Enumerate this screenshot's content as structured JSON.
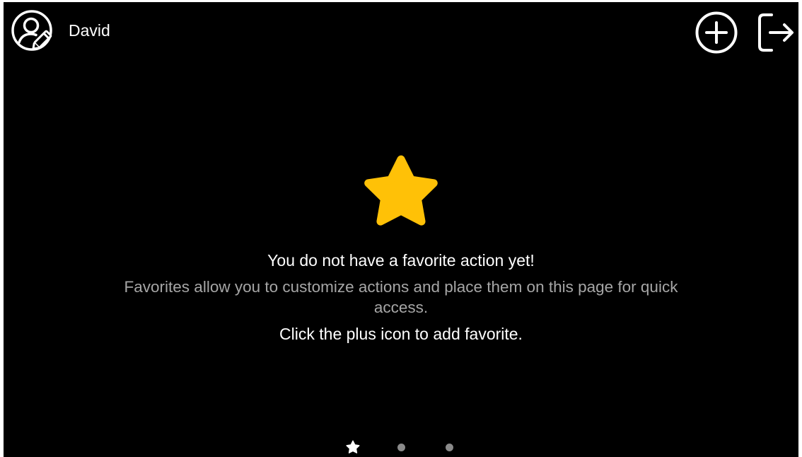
{
  "header": {
    "user_name": "David",
    "add_icon": "plus-circle-icon",
    "logout_icon": "logout-icon",
    "profile_icon": "user-edit-icon"
  },
  "empty_state": {
    "icon": "star-icon",
    "title": "You do not have a favorite action yet!",
    "description": "Favorites allow you to customize actions and place them on this page for quick access.",
    "hint": "Click the plus icon to add favorite."
  },
  "pager": {
    "pages": [
      "favorites",
      "page-2",
      "page-3"
    ],
    "active_index": 0
  },
  "colors": {
    "background": "#000000",
    "accent_star": "#FFC107",
    "text_primary": "#FFFFFF",
    "text_secondary": "#A6A6A6",
    "dot_inactive": "#8A8A8A"
  }
}
